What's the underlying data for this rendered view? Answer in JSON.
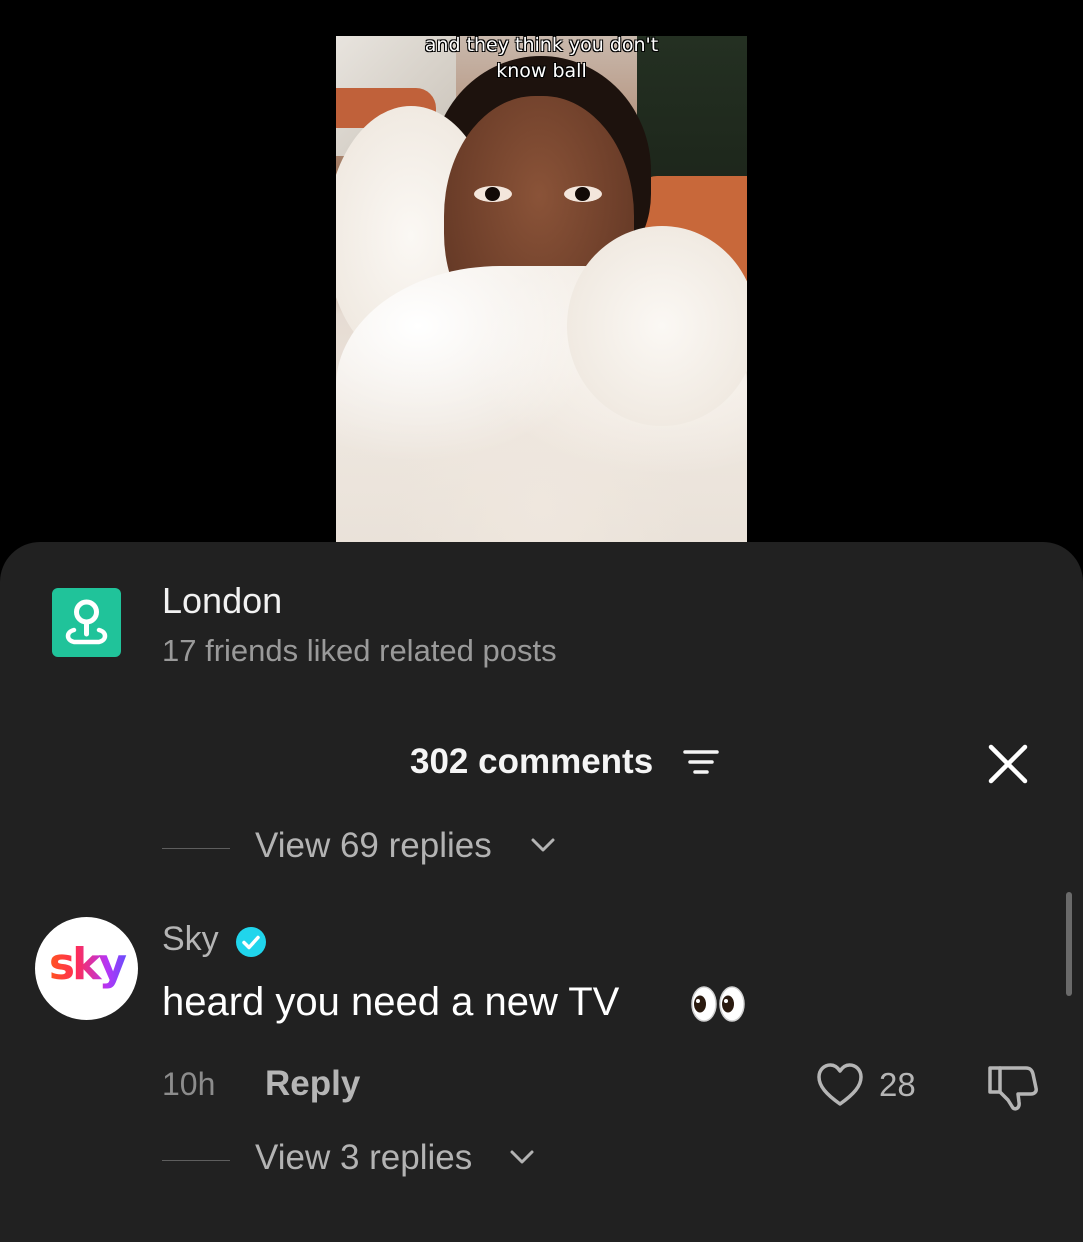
{
  "video": {
    "caption_line1": "and they think you don't",
    "caption_line2": "know ball"
  },
  "location": {
    "icon": "location-pin-icon",
    "title": "London",
    "subtitle": "17 friends liked related posts",
    "accent_color": "#20c39a"
  },
  "comments_header": {
    "title": "302 comments",
    "sort_icon": "sort-filter-icon",
    "close_icon": "close-icon"
  },
  "thread_top": {
    "view_replies_label": "View 69 replies"
  },
  "comment": {
    "avatar_text": "sky",
    "username": "Sky",
    "verified": true,
    "verified_color": "#20d5ec",
    "text": "heard you need a new TV",
    "emoji": "👀",
    "time": "10h",
    "reply_label": "Reply",
    "like_count": "28",
    "view_replies_label": "View 3 replies"
  }
}
